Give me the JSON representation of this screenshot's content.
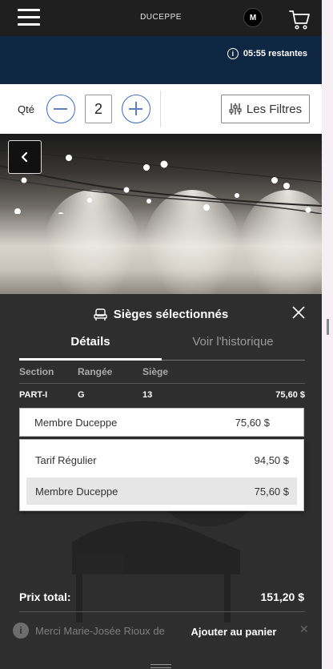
{
  "header": {
    "brand": "DUCEPPE",
    "avatar_initial": "M",
    "menu_icon": "hamburger-icon",
    "cart_icon": "cart-icon"
  },
  "timer": {
    "text": "05:55 restantes",
    "icon_glyph": "i"
  },
  "quantity": {
    "label": "Qté",
    "value": "2",
    "filters_label": "Les Filtres"
  },
  "panel": {
    "title": "Sièges sélectionnés",
    "tabs": [
      {
        "label": "Détails",
        "active": true
      },
      {
        "label": "Voir l'historique",
        "active": false
      }
    ],
    "columns": [
      "Section",
      "Rangée",
      "Siège"
    ],
    "seat": {
      "section": "PART-I",
      "row": "G",
      "seat": "13",
      "price": "75,60 $"
    },
    "selected_tariff": {
      "label": "Membre Duceppe",
      "price": "75,60 $"
    },
    "tariff_options": [
      {
        "label": "Tarif Régulier",
        "price": "94,50 $"
      },
      {
        "label": "Membre Duceppe",
        "price": "75,60 $"
      }
    ],
    "total_label": "Prix total:",
    "total_value": "151,20 $",
    "toast_text": "Merci Marie-Josée Rioux de",
    "toast_icon_glyph": "i",
    "add_to_cart_label": "Ajouter au panier"
  },
  "colors": {
    "header_bg": "#1f1f1f",
    "timer_bg": "#0f2742",
    "accent_blue": "#3a6bc4",
    "panel_bg": "#2e2e2e"
  }
}
